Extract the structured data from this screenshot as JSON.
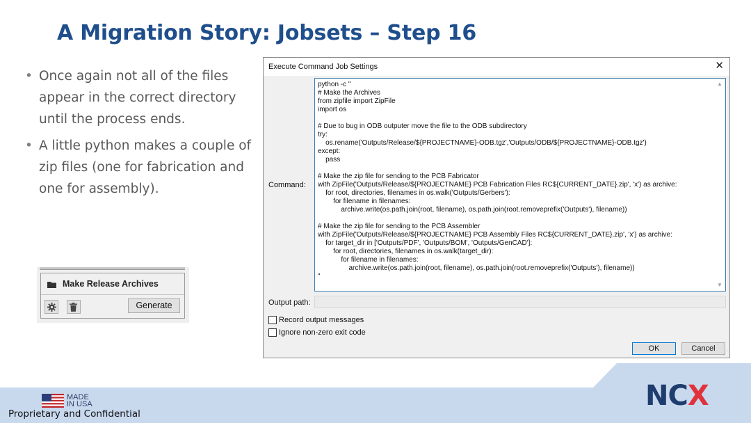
{
  "slide": {
    "title": "A Migration Story: Jobsets – Step 16",
    "bullets": [
      "Once again not all of the files appear in the correct directory until the process ends.",
      "A little python makes a couple of zip files (one for fabrication and one for assembly)."
    ]
  },
  "jobset": {
    "name": "Make Release Archives",
    "generate_label": "Generate",
    "icons": [
      "folder-icon",
      "gear-icon",
      "trash-icon"
    ]
  },
  "dialog": {
    "title": "Execute Command Job Settings",
    "close_glyph": "✕",
    "command_label": "Command:",
    "command_text": "python -c \"\n# Make the Archives\nfrom zipfile import ZipFile\nimport os\n\n# Due to bug in ODB outputer move the file to the ODB subdirectory\ntry:\n    os.rename('Outputs/Release/${PROJECTNAME}-ODB.tgz','Outputs/ODB/${PROJECTNAME}-ODB.tgz')\nexcept:\n    pass\n\n# Make the zip file for sending to the PCB Fabricator\nwith ZipFile('Outputs/Release/${PROJECTNAME} PCB Fabrication Files RC${CURRENT_DATE}.zip', 'x') as archive:\n    for root, directories, filenames in os.walk('Outputs/Gerbers'):\n        for filename in filenames:\n            archive.write(os.path.join(root, filename), os.path.join(root.removeprefix('Outputs'), filename))\n\n# Make the zip file for sending to the PCB Assembler\nwith ZipFile('Outputs/Release/${PROJECTNAME} PCB Assembly Files RC${CURRENT_DATE}.zip', 'x') as archive:\n    for target_dir in ['Outputs/PDF', 'Outputs/BOM', 'Outputs/GenCAD']:\n        for root, directories, filenames in os.walk(target_dir):\n            for filename in filenames:\n                archive.write(os.path.join(root, filename), os.path.join(root.removeprefix('Outputs'), filename))\n\"",
    "output_path_label": "Output path:",
    "output_path_value": "",
    "record_output_label": "Record output messages",
    "record_output_checked": false,
    "ignore_exit_label": "Ignore non-zero exit code",
    "ignore_exit_checked": false,
    "ok_label": "OK",
    "cancel_label": "Cancel"
  },
  "footer": {
    "made_line1": "MADE",
    "made_line2": "IN USA",
    "confidential": "Proprietary and Confidential",
    "logo_nc": "NC",
    "logo_x": "X"
  },
  "colors": {
    "title": "#1f4e8c",
    "footer_bg": "#c8d9ee",
    "logo_dark": "#1f3c6e",
    "logo_red": "#e0323c",
    "focus_border": "#3c7fb1"
  }
}
